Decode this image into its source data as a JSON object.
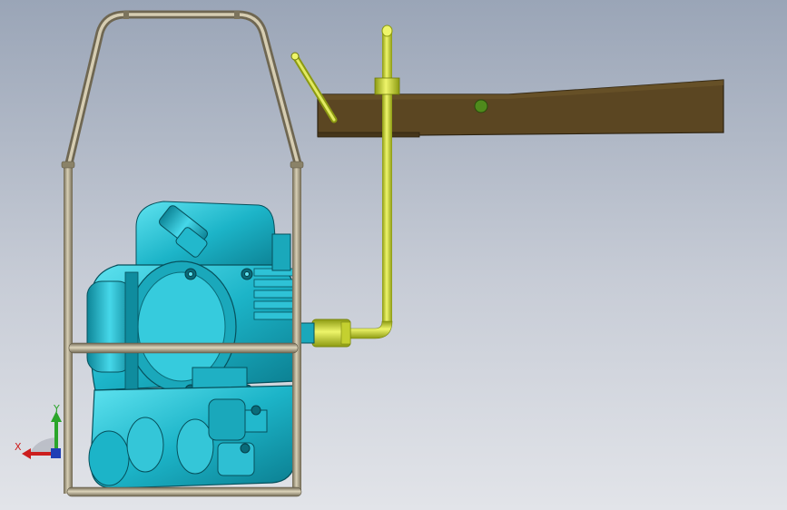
{
  "triad": {
    "x_label": "X",
    "y_label": "Y",
    "x_color": "#cc1e1e",
    "y_color": "#2aa52a"
  },
  "colors": {
    "frame_tube": "#9c9275",
    "engine_body": "#1fb6c9",
    "boom": "#5a4622",
    "rod": "#c8d83a"
  }
}
